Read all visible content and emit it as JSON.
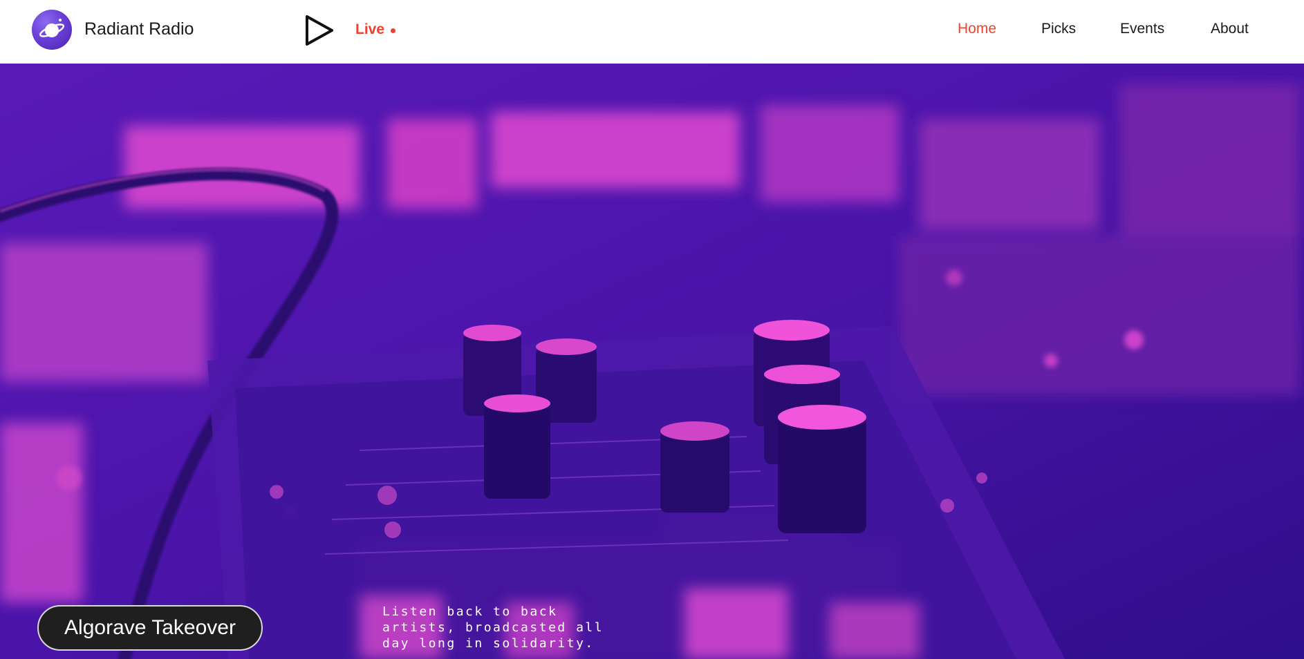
{
  "header": {
    "brand": "Radiant Radio",
    "logo_icon": "planet-icon",
    "play_icon": "play-icon",
    "live_label": "Live",
    "nav": [
      {
        "label": "Home",
        "active": true
      },
      {
        "label": "Picks",
        "active": false
      },
      {
        "label": "Events",
        "active": false
      },
      {
        "label": "About",
        "active": false
      }
    ]
  },
  "hero": {
    "show_title": "Algorave Takeover",
    "description": "Listen back to back artists, broadcasted all day long in solidarity."
  },
  "colors": {
    "accent": "#f0412f",
    "hero_base": "#3c12a0",
    "hero_highlight": "#e040c8",
    "logo": "#6a3fd8"
  }
}
